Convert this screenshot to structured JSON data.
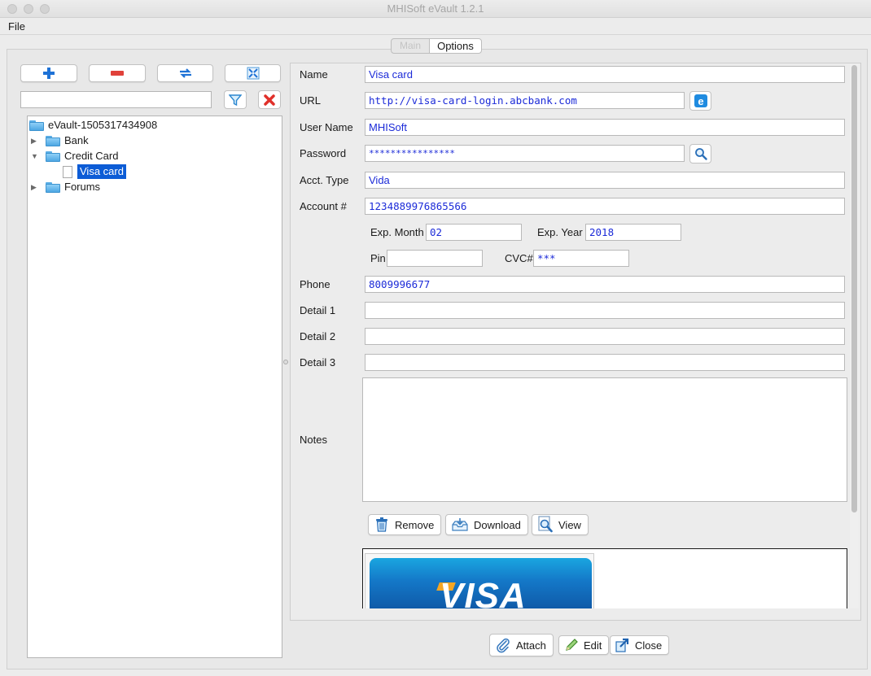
{
  "window": {
    "title": "MHISoft eVault 1.2.1"
  },
  "menu": {
    "file": "File"
  },
  "tabs": {
    "main": "Main",
    "options": "Options"
  },
  "toolbar": {
    "add_icon": "plus-icon",
    "delete_icon": "minus-icon",
    "sync_icon": "refresh-icon",
    "expand_icon": "expand-icon",
    "filter_icon": "filter-icon",
    "clear_icon": "clear-x-icon",
    "search_value": ""
  },
  "tree": {
    "root": "eVault-1505317434908",
    "items": [
      {
        "label": "Bank",
        "expanded": false
      },
      {
        "label": "Credit Card",
        "expanded": true,
        "children": [
          {
            "label": "Visa card",
            "selected": true
          }
        ]
      },
      {
        "label": "Forums",
        "expanded": false
      }
    ]
  },
  "form": {
    "name_label": "Name",
    "name_value": "Visa card",
    "url_label": "URL",
    "url_value": "http://visa-card-login.abcbank.com",
    "username_label": "User Name",
    "username_value": "MHISoft",
    "password_label": "Password",
    "password_value": "****************",
    "accttype_label": "Acct. Type",
    "accttype_value": "Vida",
    "account_label": "Account #",
    "account_value": "1234889976865566",
    "expmonth_label": "Exp. Month",
    "expmonth_value": "02",
    "expyear_label": "Exp. Year",
    "expyear_value": "2018",
    "pin_label": "Pin",
    "pin_value": "",
    "cvc_label": "CVC#",
    "cvc_value": "***",
    "phone_label": "Phone",
    "phone_value": "8009996677",
    "detail1_label": "Detail 1",
    "detail1_value": "",
    "detail2_label": "Detail 2",
    "detail2_value": "",
    "detail3_label": "Detail 3",
    "detail3_value": "",
    "notes_label": "Notes",
    "notes_value": ""
  },
  "attachment_buttons": {
    "remove": "Remove",
    "download": "Download",
    "view": "View"
  },
  "attachment_image": {
    "text": "VISA"
  },
  "bottom_buttons": {
    "attach": "Attach",
    "edit": "Edit",
    "close": "Close"
  },
  "colors": {
    "field_text": "#1c2bd8",
    "selection": "#0c5cd6",
    "folder": "#5aaee6"
  }
}
